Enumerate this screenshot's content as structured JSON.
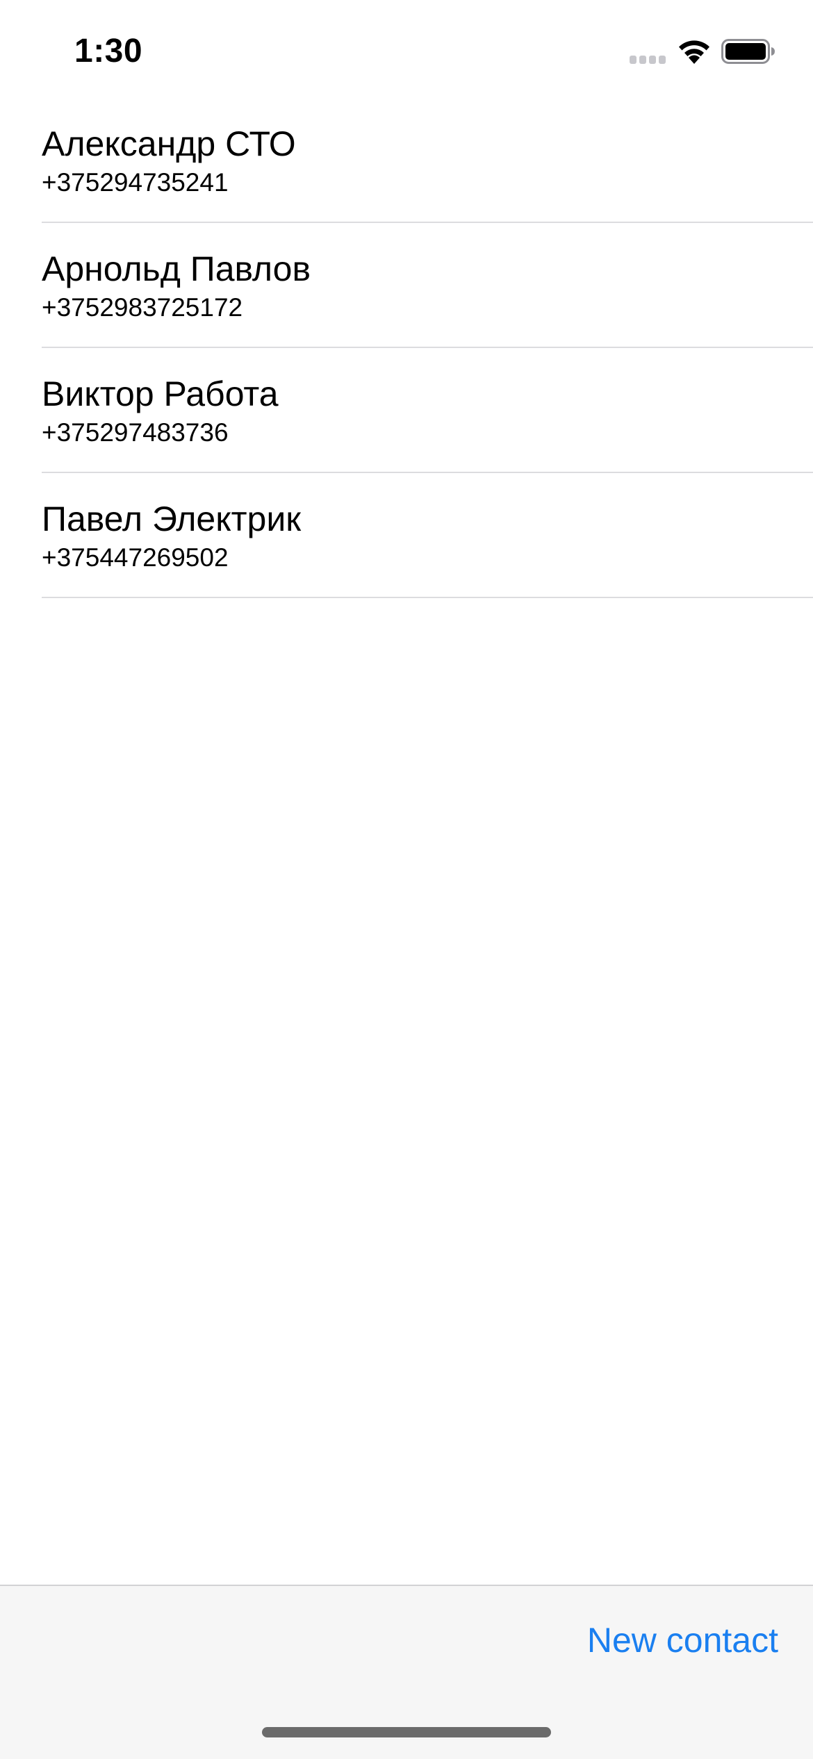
{
  "status_bar": {
    "time": "1:30",
    "icons": [
      "cellular-signal-icon",
      "wifi-icon",
      "battery-icon"
    ]
  },
  "contacts": [
    {
      "name": "Александр СТО",
      "phone": "+375294735241"
    },
    {
      "name": "Арнольд Павлов",
      "phone": "+3752983725172"
    },
    {
      "name": "Виктор Работа",
      "phone": "+375297483736"
    },
    {
      "name": "Павел Электрик",
      "phone": "+375447269502"
    }
  ],
  "toolbar": {
    "new_contact_label": "New contact"
  },
  "colors": {
    "accent": "#1a7ff0",
    "separator": "#dcdcdf",
    "toolbar_bg": "#f6f6f6"
  }
}
